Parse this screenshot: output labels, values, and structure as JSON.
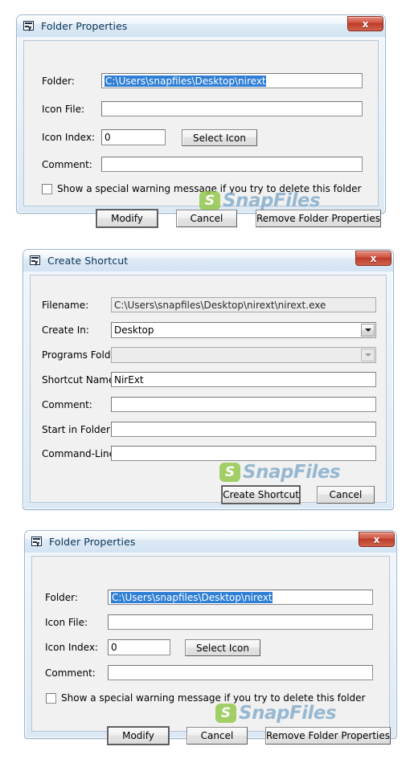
{
  "colors": {
    "title_text": "#0b3558",
    "close_button_red": "#bc3a27",
    "selection_blue": "#2f7fd6",
    "client_bg": "#f1f1f1",
    "watermark_green": "#8cc63f",
    "watermark_blue": "#7fa9c9"
  },
  "watermark": {
    "logo_letter": "S",
    "text": "SnapFiles"
  },
  "dialog1": {
    "title": "Folder Properties",
    "icon": "nirext-window-icon",
    "close_label": "x",
    "fields": [
      {
        "label": "Folder:",
        "value": "C:\\Users\\snapfiles\\Desktop\\nirext",
        "selected": true
      },
      {
        "label": "Icon File:",
        "value": ""
      },
      {
        "label": "Icon Index:",
        "value": "0"
      },
      {
        "label": "Comment:",
        "value": ""
      }
    ],
    "select_icon_label": "Select Icon",
    "checkbox": {
      "label": "Show a special warning message if you try to delete this folder",
      "checked": false
    },
    "buttons": [
      {
        "label": "Modify",
        "default": true
      },
      {
        "label": "Cancel",
        "default": false
      },
      {
        "label": "Remove Folder Properties",
        "default": false
      }
    ]
  },
  "dialog2": {
    "title": "Create Shortcut",
    "icon": "nirext-window-icon",
    "close_label": "x",
    "fields": [
      {
        "label": "Filename:",
        "value": "C:\\Users\\snapfiles\\Desktop\\nirext\\nirext.exe",
        "disabled": true
      },
      {
        "label": "Create In:",
        "value": "Desktop",
        "combo": true
      },
      {
        "label": "Programs Folder:",
        "value": "",
        "combo": true,
        "disabled": true
      },
      {
        "label": "Shortcut Name:",
        "value": "NirExt"
      },
      {
        "label": "Comment:",
        "value": ""
      },
      {
        "label": "Start in Folder:",
        "value": ""
      },
      {
        "label": "Command-Line:",
        "value": ""
      }
    ],
    "buttons": [
      {
        "label": "Create Shortcut",
        "default": true
      },
      {
        "label": "Cancel",
        "default": false
      }
    ]
  },
  "dialog3": {
    "title": "Folder Properties",
    "icon": "nirext-window-icon",
    "close_label": "x",
    "fields": [
      {
        "label": "Folder:",
        "value": "C:\\Users\\snapfiles\\Desktop\\nirext",
        "selected": true
      },
      {
        "label": "Icon File:",
        "value": ""
      },
      {
        "label": "Icon Index:",
        "value": "0"
      },
      {
        "label": "Comment:",
        "value": ""
      }
    ],
    "select_icon_label": "Select Icon",
    "checkbox": {
      "label": "Show a special warning message if you try to delete this folder",
      "checked": false
    },
    "buttons": [
      {
        "label": "Modify",
        "default": true
      },
      {
        "label": "Cancel",
        "default": false
      },
      {
        "label": "Remove Folder Properties",
        "default": false
      }
    ]
  }
}
